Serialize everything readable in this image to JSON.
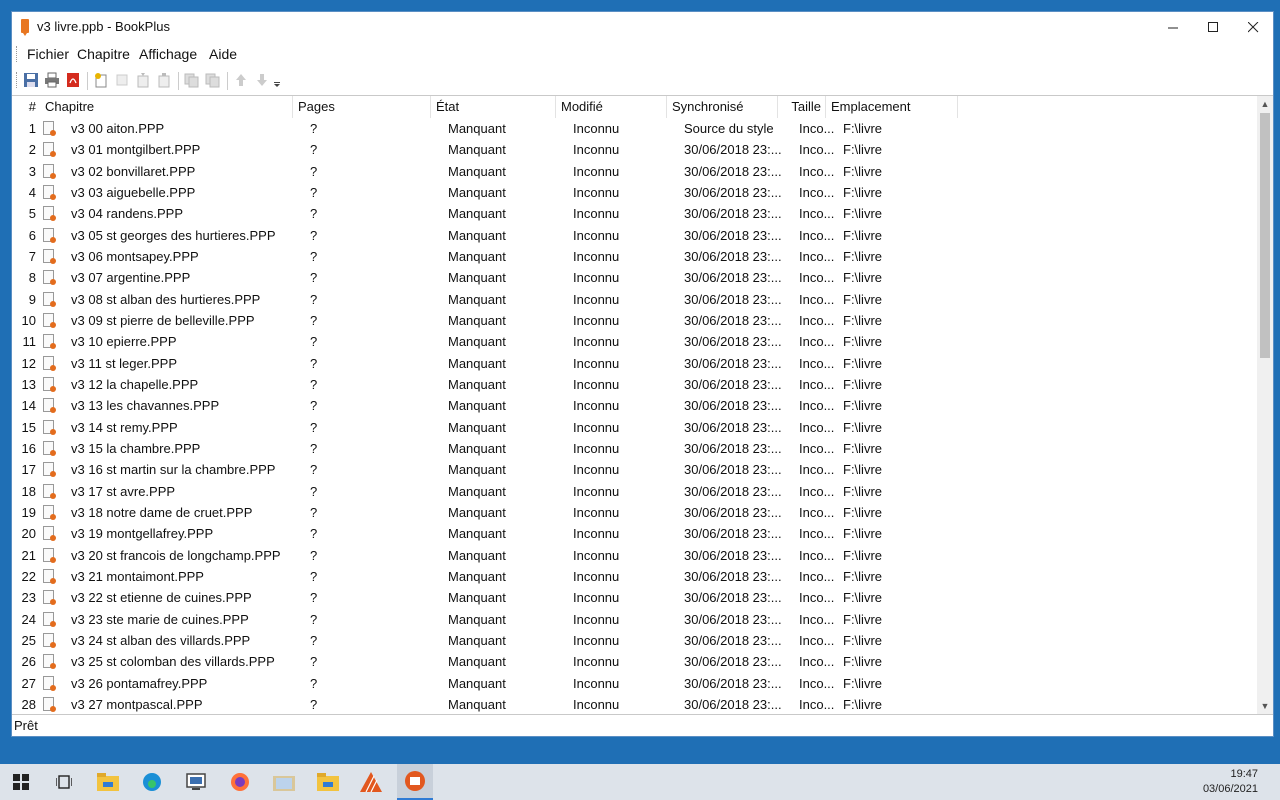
{
  "window": {
    "title": "v3 livre.ppb - BookPlus"
  },
  "menu": [
    "Fichier",
    "Chapitre",
    "Affichage",
    "Aide"
  ],
  "toolbar": [
    "save-icon",
    "print-icon",
    "pdf-icon",
    "add-chapter-icon",
    "new-chapter-icon",
    "import-icon",
    "export-icon",
    "copy-icon",
    "paste-icon",
    "move-up-icon",
    "move-down-icon",
    "toolbar-overflow-icon"
  ],
  "columns": [
    "#",
    "Chapitre",
    "Pages",
    "État",
    "Modifié",
    "Synchronisé",
    "Taille",
    "Emplacement"
  ],
  "rows": [
    [
      "1",
      "v3 00 aiton.PPP",
      "?",
      "Manquant",
      "Inconnu",
      "Source du style",
      "Inco...",
      "F:\\livre"
    ],
    [
      "2",
      "v3 01 montgilbert.PPP",
      "?",
      "Manquant",
      "Inconnu",
      "30/06/2018 23:...",
      "Inco...",
      "F:\\livre"
    ],
    [
      "3",
      "v3 02 bonvillaret.PPP",
      "?",
      "Manquant",
      "Inconnu",
      "30/06/2018 23:...",
      "Inco...",
      "F:\\livre"
    ],
    [
      "4",
      "v3 03 aiguebelle.PPP",
      "?",
      "Manquant",
      "Inconnu",
      "30/06/2018 23:...",
      "Inco...",
      "F:\\livre"
    ],
    [
      "5",
      "v3 04 randens.PPP",
      "?",
      "Manquant",
      "Inconnu",
      "30/06/2018 23:...",
      "Inco...",
      "F:\\livre"
    ],
    [
      "6",
      "v3 05 st georges des hurtieres.PPP",
      "?",
      "Manquant",
      "Inconnu",
      "30/06/2018 23:...",
      "Inco...",
      "F:\\livre"
    ],
    [
      "7",
      "v3 06 montsapey.PPP",
      "?",
      "Manquant",
      "Inconnu",
      "30/06/2018 23:...",
      "Inco...",
      "F:\\livre"
    ],
    [
      "8",
      "v3 07 argentine.PPP",
      "?",
      "Manquant",
      "Inconnu",
      "30/06/2018 23:...",
      "Inco...",
      "F:\\livre"
    ],
    [
      "9",
      "v3 08 st alban des hurtieres.PPP",
      "?",
      "Manquant",
      "Inconnu",
      "30/06/2018 23:...",
      "Inco...",
      "F:\\livre"
    ],
    [
      "10",
      "v3 09 st pierre de belleville.PPP",
      "?",
      "Manquant",
      "Inconnu",
      "30/06/2018 23:...",
      "Inco...",
      "F:\\livre"
    ],
    [
      "11",
      "v3 10 epierre.PPP",
      "?",
      "Manquant",
      "Inconnu",
      "30/06/2018 23:...",
      "Inco...",
      "F:\\livre"
    ],
    [
      "12",
      "v3 11 st leger.PPP",
      "?",
      "Manquant",
      "Inconnu",
      "30/06/2018 23:...",
      "Inco...",
      "F:\\livre"
    ],
    [
      "13",
      "v3 12 la chapelle.PPP",
      "?",
      "Manquant",
      "Inconnu",
      "30/06/2018 23:...",
      "Inco...",
      "F:\\livre"
    ],
    [
      "14",
      "v3 13 les chavannes.PPP",
      "?",
      "Manquant",
      "Inconnu",
      "30/06/2018 23:...",
      "Inco...",
      "F:\\livre"
    ],
    [
      "15",
      "v3 14 st remy.PPP",
      "?",
      "Manquant",
      "Inconnu",
      "30/06/2018 23:...",
      "Inco...",
      "F:\\livre"
    ],
    [
      "16",
      "v3 15 la chambre.PPP",
      "?",
      "Manquant",
      "Inconnu",
      "30/06/2018 23:...",
      "Inco...",
      "F:\\livre"
    ],
    [
      "17",
      "v3 16 st martin sur la chambre.PPP",
      "?",
      "Manquant",
      "Inconnu",
      "30/06/2018 23:...",
      "Inco...",
      "F:\\livre"
    ],
    [
      "18",
      "v3 17 st avre.PPP",
      "?",
      "Manquant",
      "Inconnu",
      "30/06/2018 23:...",
      "Inco...",
      "F:\\livre"
    ],
    [
      "19",
      "v3 18 notre dame de cruet.PPP",
      "?",
      "Manquant",
      "Inconnu",
      "30/06/2018 23:...",
      "Inco...",
      "F:\\livre"
    ],
    [
      "20",
      "v3 19 montgellafrey.PPP",
      "?",
      "Manquant",
      "Inconnu",
      "30/06/2018 23:...",
      "Inco...",
      "F:\\livre"
    ],
    [
      "21",
      "v3 20 st francois de longchamp.PPP",
      "?",
      "Manquant",
      "Inconnu",
      "30/06/2018 23:...",
      "Inco...",
      "F:\\livre"
    ],
    [
      "22",
      "v3 21 montaimont.PPP",
      "?",
      "Manquant",
      "Inconnu",
      "30/06/2018 23:...",
      "Inco...",
      "F:\\livre"
    ],
    [
      "23",
      "v3 22 st etienne de cuines.PPP",
      "?",
      "Manquant",
      "Inconnu",
      "30/06/2018 23:...",
      "Inco...",
      "F:\\livre"
    ],
    [
      "24",
      "v3 23 ste marie de cuines.PPP",
      "?",
      "Manquant",
      "Inconnu",
      "30/06/2018 23:...",
      "Inco...",
      "F:\\livre"
    ],
    [
      "25",
      "v3 24 st alban des villards.PPP",
      "?",
      "Manquant",
      "Inconnu",
      "30/06/2018 23:...",
      "Inco...",
      "F:\\livre"
    ],
    [
      "26",
      "v3 25 st colomban des villards.PPP",
      "?",
      "Manquant",
      "Inconnu",
      "30/06/2018 23:...",
      "Inco...",
      "F:\\livre"
    ],
    [
      "27",
      "v3 26 pontamafrey.PPP",
      "?",
      "Manquant",
      "Inconnu",
      "30/06/2018 23:...",
      "Inco...",
      "F:\\livre"
    ],
    [
      "28",
      "v3 27 montpascal.PPP",
      "?",
      "Manquant",
      "Inconnu",
      "30/06/2018 23:...",
      "Inco...",
      "F:\\livre"
    ]
  ],
  "status": "Prêt",
  "taskbar": {
    "apps": [
      "windows-start-icon",
      "task-view-icon",
      "file-explorer-icon",
      "edge-icon",
      "network-icon",
      "firefox-icon",
      "folder-icon",
      "folder-icon",
      "app-icon",
      "bookplus-icon"
    ],
    "time": "19:47",
    "date": "03/06/2021"
  },
  "colors": {
    "desktop": "#1f6fb5",
    "accent": "#e87722"
  }
}
